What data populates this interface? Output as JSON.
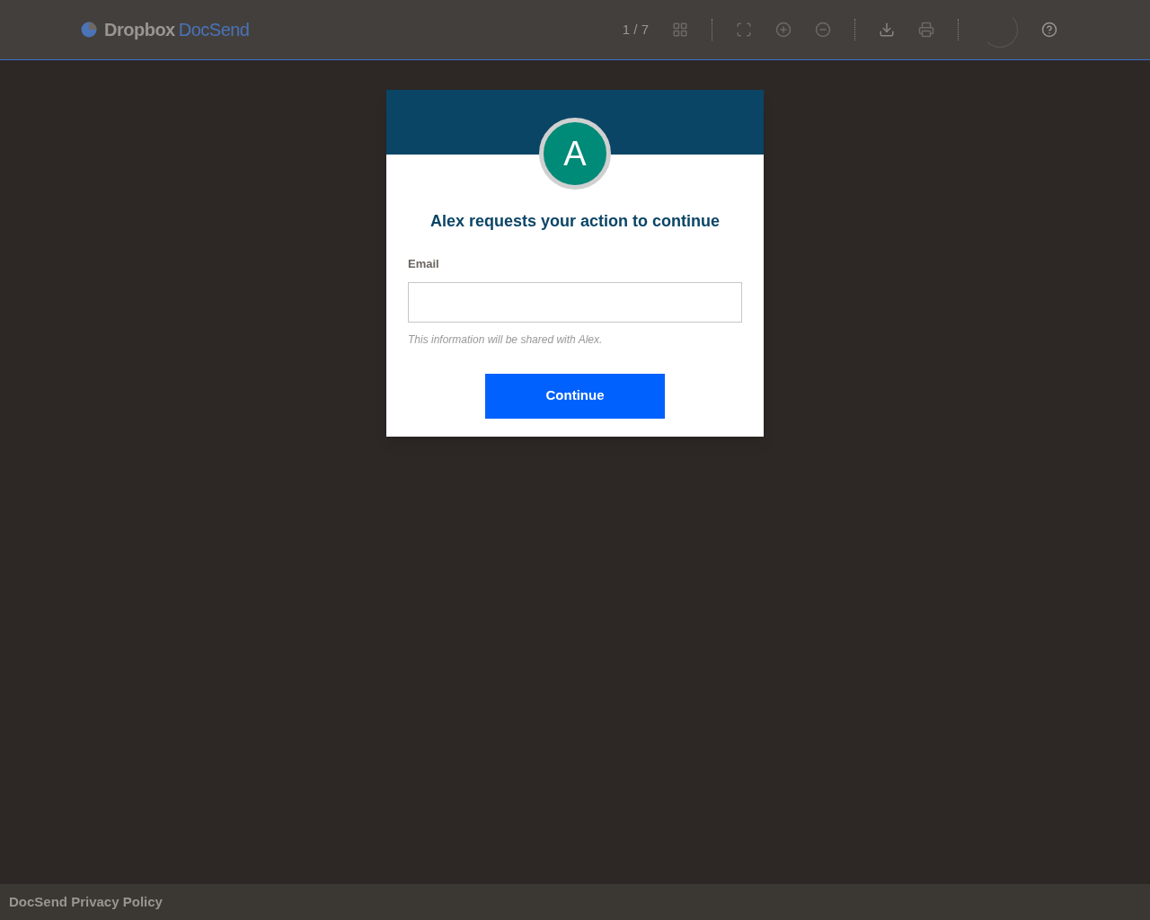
{
  "header": {
    "brand": "Dropbox",
    "product": "DocSend",
    "page_counter": "1 / 7"
  },
  "dialog": {
    "avatar_letter": "A",
    "title": "Alex requests your action to continue",
    "email_label": "Email",
    "hint": "This information will be shared with Alex.",
    "button": "Continue"
  },
  "footer": {
    "link": "DocSend Privacy Policy"
  }
}
